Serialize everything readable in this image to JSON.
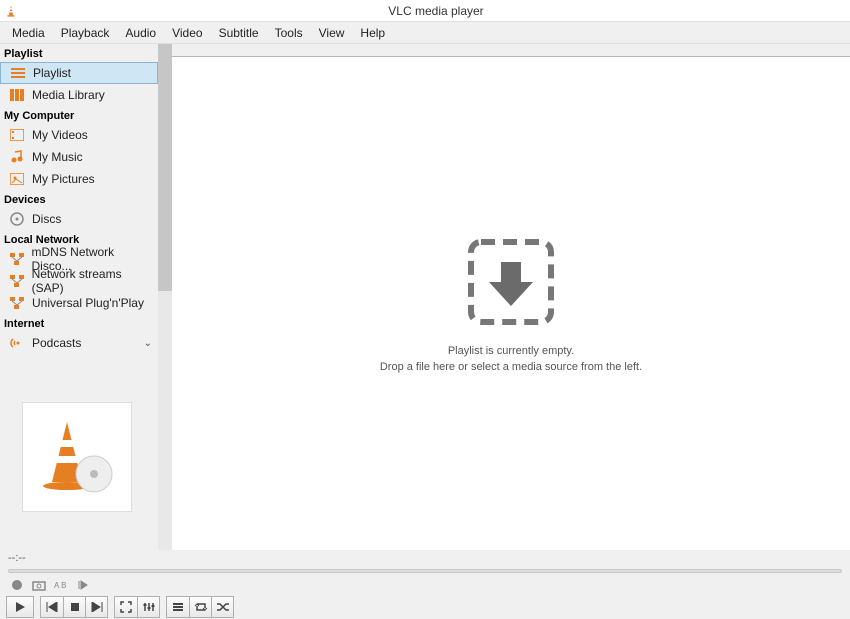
{
  "window": {
    "title": "VLC media player"
  },
  "menu": [
    "Media",
    "Playback",
    "Audio",
    "Video",
    "Subtitle",
    "Tools",
    "View",
    "Help"
  ],
  "sidebar": {
    "sections": [
      {
        "title": "Playlist",
        "items": [
          {
            "label": "Playlist",
            "icon": "playlist",
            "selected": true
          },
          {
            "label": "Media Library",
            "icon": "library"
          }
        ]
      },
      {
        "title": "My Computer",
        "items": [
          {
            "label": "My Videos",
            "icon": "video"
          },
          {
            "label": "My Music",
            "icon": "music"
          },
          {
            "label": "My Pictures",
            "icon": "picture"
          }
        ]
      },
      {
        "title": "Devices",
        "items": [
          {
            "label": "Discs",
            "icon": "disc"
          }
        ]
      },
      {
        "title": "Local Network",
        "items": [
          {
            "label": "mDNS Network Disco...",
            "icon": "network"
          },
          {
            "label": "Network streams (SAP)",
            "icon": "network"
          },
          {
            "label": "Universal Plug'n'Play",
            "icon": "network"
          }
        ]
      },
      {
        "title": "Internet",
        "items": [
          {
            "label": "Podcasts",
            "icon": "podcast",
            "chevron": true
          }
        ]
      }
    ]
  },
  "empty_state": {
    "line1": "Playlist is currently empty.",
    "line2": "Drop a file here or select a media source from the left."
  },
  "time_display": "--:--",
  "colors": {
    "accent": "#e67e22",
    "selection": "#cfe6f5"
  }
}
